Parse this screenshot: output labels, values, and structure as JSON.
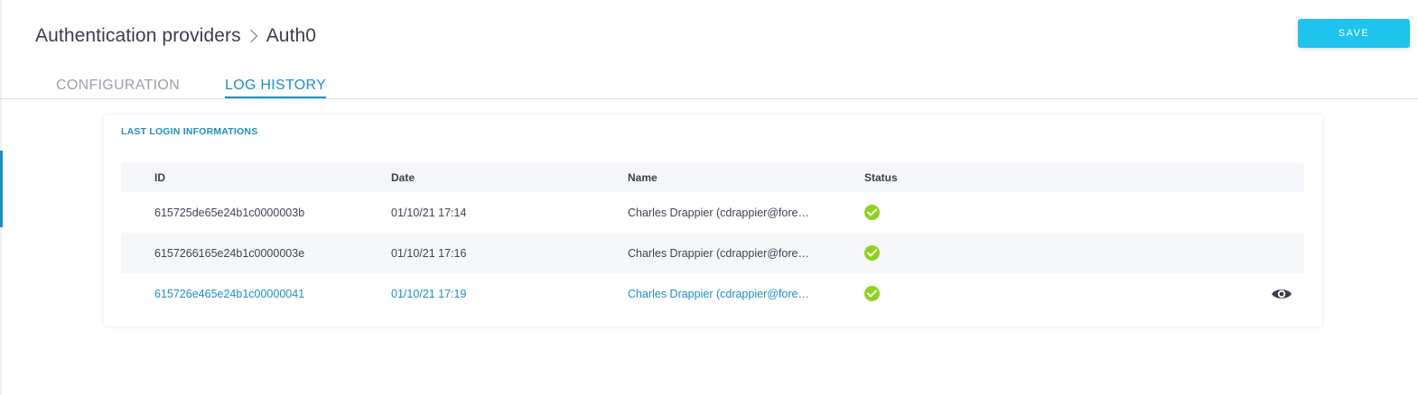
{
  "header": {
    "breadcrumb_parent": "Authentication providers",
    "breadcrumb_current": "Auth0"
  },
  "toolbar": {
    "save_label": "SAVE"
  },
  "tabs": [
    {
      "label": "CONFIGURATION",
      "active": false
    },
    {
      "label": "LOG HISTORY",
      "active": true
    }
  ],
  "card": {
    "title": "LAST LOGIN INFORMATIONS",
    "columns": [
      "ID",
      "Date",
      "Name",
      "Status"
    ],
    "rows": [
      {
        "id": "615725de65e24b1c0000003b",
        "date": "01/10/21 17:14",
        "name": "Charles Drappier (cdrappier@fore…",
        "status": "success"
      },
      {
        "id": "6157266165e24b1c0000003e",
        "date": "01/10/21 17:16",
        "name": "Charles Drappier (cdrappier@fore…",
        "status": "success"
      },
      {
        "id": "615726e465e24b1c00000041",
        "date": "01/10/21 17:19",
        "name": "Charles Drappier (cdrappier@fore…",
        "status": "success"
      }
    ]
  },
  "icons": {
    "status_success": "check-circle-icon",
    "view": "eye-icon",
    "breadcrumb_separator": "chevron-right-icon"
  },
  "colors": {
    "accent": "#1d8fc2",
    "save_button": "#1ec3ee",
    "success": "#8fd11f"
  }
}
